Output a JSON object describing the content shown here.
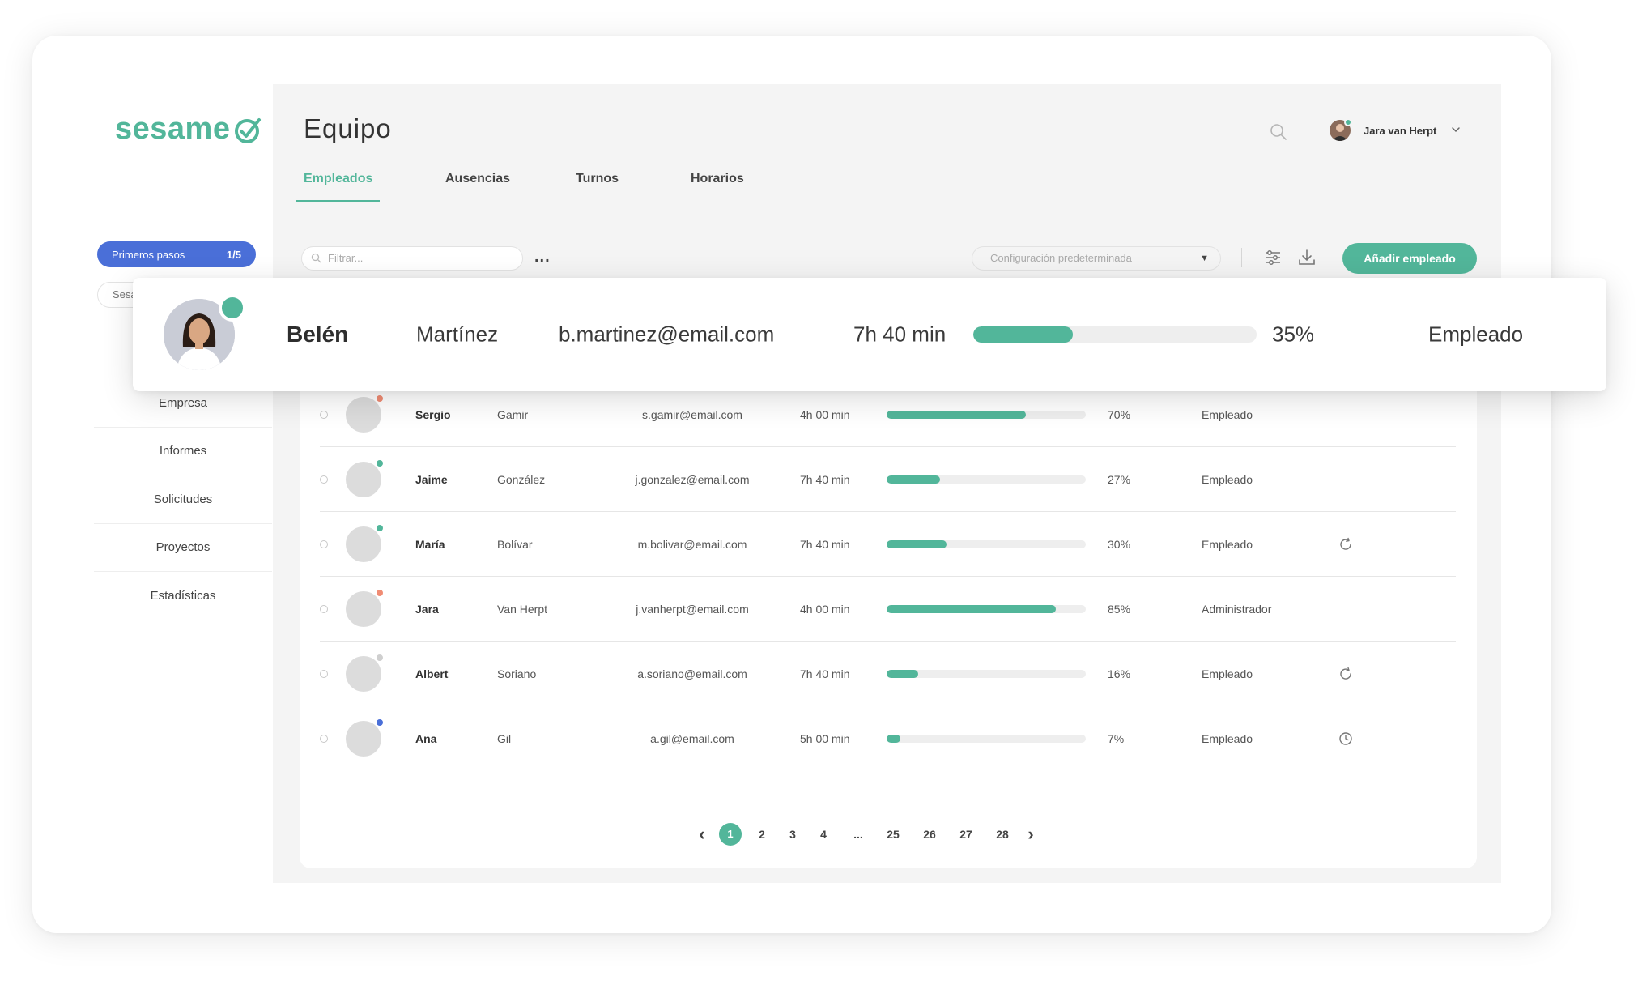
{
  "brand": {
    "name": "sesame",
    "color": "#52b69a"
  },
  "sidebar": {
    "steps": {
      "label": "Primeros pasos",
      "count": "1/5"
    },
    "search_text": "Sesa",
    "items": [
      "Empresa",
      "Informes",
      "Solicitudes",
      "Proyectos",
      "Estadísticas"
    ]
  },
  "header": {
    "title": "Equipo",
    "user_name": "Jara van Herpt",
    "icons": [
      "search-icon",
      "chevron-down-icon"
    ]
  },
  "tabs": [
    {
      "label": "Empleados",
      "active": true
    },
    {
      "label": "Ausencias",
      "active": false
    },
    {
      "label": "Turnos",
      "active": false
    },
    {
      "label": "Horarios",
      "active": false
    }
  ],
  "toolbar": {
    "filter_placeholder": "Filtrar...",
    "more_label": "...",
    "config_value": "Configuración predeterminada",
    "add_label": "Añadir empleado",
    "icons": [
      "sliders-icon",
      "download-icon"
    ]
  },
  "highlight": {
    "first": "Belén",
    "last": "Martínez",
    "email": "b.martinez@email.com",
    "hours": "7h 40 min",
    "progress": 0.35,
    "pct": "35%",
    "role": "Empleado",
    "status_color": "#52b69a"
  },
  "employees": [
    {
      "first": "Sergio",
      "last": "Gamir",
      "email": "s.gamir@email.com",
      "hours": "4h 00 min",
      "progress": 0.7,
      "pct": "70%",
      "role": "Empleado",
      "status_color": "#f08c74",
      "icon": ""
    },
    {
      "first": "Jaime",
      "last": "González",
      "email": "j.gonzalez@email.com",
      "hours": "7h 40 min",
      "progress": 0.27,
      "pct": "27%",
      "role": "Empleado",
      "status_color": "#52b69a",
      "icon": ""
    },
    {
      "first": "María",
      "last": "Bolívar",
      "email": "m.bolivar@email.com",
      "hours": "7h 40 min",
      "progress": 0.3,
      "pct": "30%",
      "role": "Empleado",
      "status_color": "#52b69a",
      "icon": "refresh-icon"
    },
    {
      "first": "Jara",
      "last": "Van Herpt",
      "email": "j.vanherpt@email.com",
      "hours": "4h 00 min",
      "progress": 0.85,
      "pct": "85%",
      "role": "Administrador",
      "status_color": "#f08c74",
      "icon": ""
    },
    {
      "first": "Albert",
      "last": "Soriano",
      "email": "a.soriano@email.com",
      "hours": "7h 40 min",
      "progress": 0.16,
      "pct": "16%",
      "role": "Empleado",
      "status_color": "#cfcfcf",
      "icon": "refresh-icon"
    },
    {
      "first": "Ana",
      "last": "Gil",
      "email": "a.gil@email.com",
      "hours": "5h 00 min",
      "progress": 0.07,
      "pct": "7%",
      "role": "Empleado",
      "status_color": "#4a6fd8",
      "icon": "clock-icon"
    }
  ],
  "pagination": {
    "prev": "‹",
    "next": "›",
    "pages": [
      "1",
      "2",
      "3",
      "4",
      "...",
      "25",
      "26",
      "27",
      "28"
    ],
    "current": "1"
  }
}
